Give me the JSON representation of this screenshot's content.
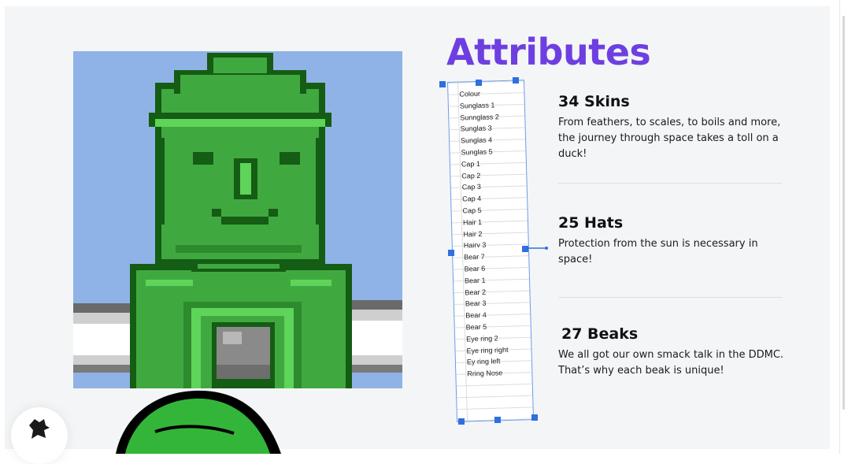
{
  "heading": "Attributes",
  "sheet_rows": [
    "Colour",
    "Sunglass 1",
    "Sunnglass 2",
    "Sunglas 3",
    "Sunglas 4",
    "Sunglas 5",
    "Cap 1",
    "Cap 2",
    "Cap 3",
    "Cap 4",
    "Cap 5",
    "Hair 1",
    "Hair 2",
    "Hairv 3",
    "Bear 7",
    "Bear 6",
    "Bear 1",
    "Bear 2",
    "Bear 3",
    "Bear 4",
    "Bear 5",
    "Eye ring 2",
    "Eye ring right",
    "Ey ring left",
    "Rring Nose"
  ],
  "attributes": [
    {
      "title": "34 Skins",
      "text": "From feathers, to scales, to boils and more, the journey through space takes a toll on a duck!"
    },
    {
      "title": "25 Hats",
      "text": "Protection from the sun is necessary in space!"
    },
    {
      "title": "27 Beaks",
      "text": "We all got our own smack talk in the DDMC. That’s why each beak is unique!"
    }
  ],
  "colors": {
    "heading": "#6e3fe0",
    "art_background": "#8fb3e6",
    "skin_base": "#3fa940",
    "skin_light": "#5fd45a",
    "outline": "#155c14",
    "selection": "#2f6fe0"
  },
  "icons": [
    "duck-logo-icon"
  ]
}
